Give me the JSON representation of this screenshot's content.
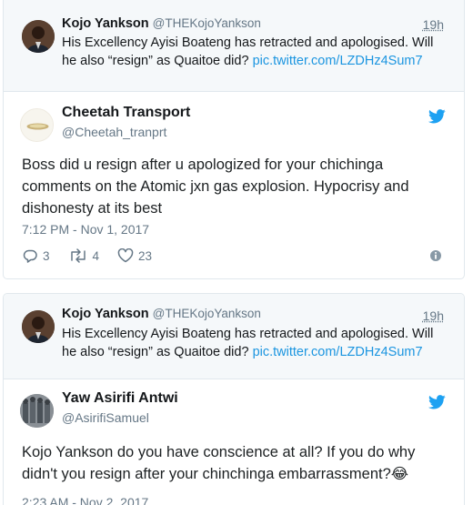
{
  "tweet1": {
    "reply_context": {
      "name": "Kojo Yankson",
      "handle": "@THEKojoYankson",
      "time": "19h",
      "text": "His Excellency Ayisi Boateng has retracted and apologised. Will he also “resign” as Quaitoe did? ",
      "link": "pic.twitter.com/LZDHz4Sum7"
    },
    "author": {
      "name": "Cheetah Transport",
      "handle": "@Cheetah_tranprt"
    },
    "text": "Boss did u resign after u apologized for your chichinga comments on the Atomic jxn gas explosion. Hypocrisy and dishonesty at its best",
    "timestamp": "7:12 PM - Nov 1, 2017",
    "stats": {
      "replies": "3",
      "retweets": "4",
      "likes": "23"
    },
    "colors": {
      "link": "#1b95e0",
      "bird": "#1da1f2"
    },
    "icons": [
      "reply-icon",
      "retweet-icon",
      "like-icon",
      "info-icon",
      "twitter-bird-icon"
    ]
  },
  "tweet2": {
    "reply_context": {
      "name": "Kojo Yankson",
      "handle": "@THEKojoYankson",
      "time": "19h",
      "text": "His Excellency Ayisi Boateng has retracted and apologised. Will he also “resign” as Quaitoe did? ",
      "link": "pic.twitter.com/LZDHz4Sum7"
    },
    "author": {
      "name": "Yaw Asirifi Antwi",
      "handle": "@AsirifiSamuel"
    },
    "text": "Kojo Yankson do you have conscience at all? If you do why didn't you resign after your chinchinga embarrassment?",
    "emoji": "😂",
    "timestamp": "2:23 AM - Nov 2, 2017"
  }
}
